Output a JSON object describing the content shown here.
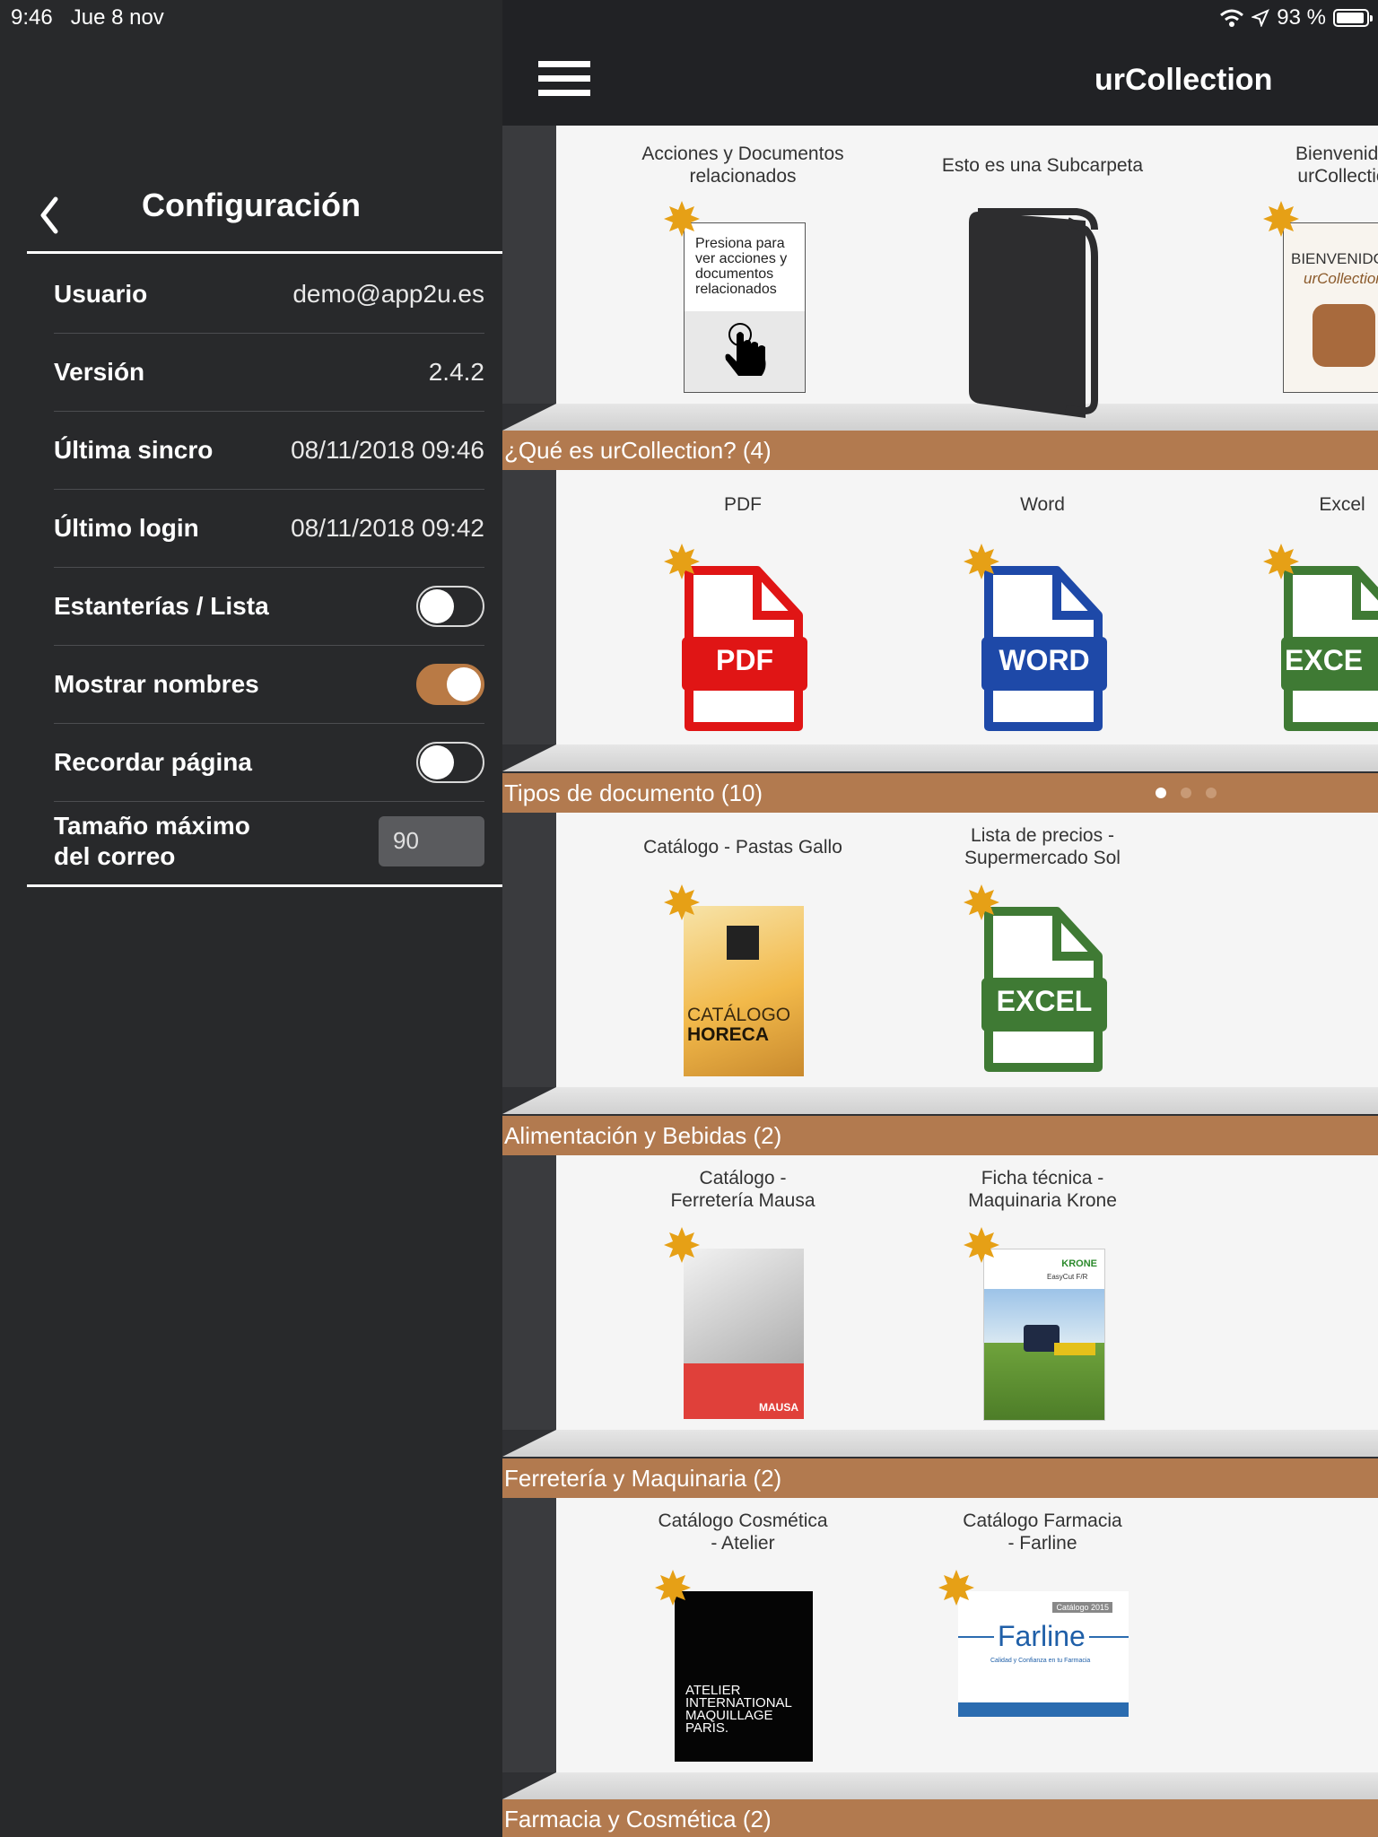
{
  "status": {
    "time": "9:46",
    "date": "Jue 8 nov",
    "battery": "93 %"
  },
  "config": {
    "title": "Configuración",
    "rows": [
      {
        "label": "Usuario",
        "value": "demo@app2u.es"
      },
      {
        "label": "Versión",
        "value": "2.4.2"
      },
      {
        "label": "Última sincro",
        "value": "08/11/2018 09:46"
      },
      {
        "label": "Último login",
        "value": "08/11/2018 09:42"
      }
    ],
    "toggles": [
      {
        "label": "Estanterías / Lista",
        "on": false
      },
      {
        "label": "Mostrar nombres",
        "on": true
      },
      {
        "label": "Recordar página",
        "on": false
      }
    ],
    "mail_label_1": "Tamaño máximo",
    "mail_label_2": "del correo",
    "mail_value": "90"
  },
  "app": {
    "title": "urCollection"
  },
  "shelves": [
    {
      "items": [
        {
          "label1": "Acciones y Documentos",
          "label2": "relacionados",
          "card_text": "Presiona para ver acciones y documentos relacionados"
        },
        {
          "label1": "Esto es una Subcarpeta",
          "label2": ""
        },
        {
          "label1": "Bienvenido",
          "label2": "urCollectio",
          "card_text1": "BIENVENIDO",
          "card_text2": "urCollection"
        }
      ]
    },
    {
      "band": "¿Qué es urCollection? (4)",
      "items": [
        {
          "label1": "PDF",
          "file_badge": "PDF"
        },
        {
          "label1": "Word",
          "file_badge": "WORD"
        },
        {
          "label1": "Excel",
          "file_badge": "EXCE"
        }
      ]
    },
    {
      "band": "Tipos de documento (10)",
      "items": [
        {
          "label1": "Catálogo - Pastas Gallo",
          "cover_text1": "CATÁLOGO",
          "cover_text2": "HORECA"
        },
        {
          "label1": "Lista de precios -",
          "label2": "Supermercado Sol",
          "file_badge": "EXCEL"
        }
      ]
    },
    {
      "band": "Alimentación y Bebidas (2)",
      "items": [
        {
          "label1": "Catálogo -",
          "label2": "Ferretería Mausa",
          "cover_text": "MAUSA"
        },
        {
          "label1": "Ficha técnica -",
          "label2": "Maquinaria Krone",
          "cover_text": "KRONE",
          "cover_sub": "EasyCut F/R"
        }
      ]
    },
    {
      "band": "Ferretería y Maquinaria (2)",
      "items": [
        {
          "label1": "Catálogo Cosmética",
          "label2": "- Atelier",
          "cover_text": "ATELIER INTERNATIONAL MAQUILLAGE PARIS."
        },
        {
          "label1": "Catálogo Farmacia",
          "label2": "- Farline",
          "cover_text": "Farline",
          "cover_sub": "Calidad y Confianza en tu Farmacia",
          "cover_tag": "Catálogo 2015"
        }
      ]
    },
    {
      "band": "Farmacia y Cosmética (2)",
      "items": []
    }
  ]
}
